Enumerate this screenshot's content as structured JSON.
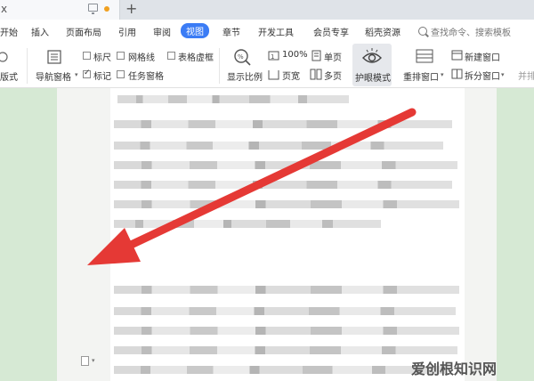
{
  "titlebar": {
    "tab_close_glyph": "x",
    "new_tab_glyph": "+"
  },
  "menu": {
    "items": [
      {
        "label": "开始",
        "active": false
      },
      {
        "label": "插入",
        "active": false
      },
      {
        "label": "页面布局",
        "active": false
      },
      {
        "label": "引用",
        "active": false
      },
      {
        "label": "审阅",
        "active": false
      },
      {
        "label": "视图",
        "active": true
      },
      {
        "label": "章节",
        "active": false
      },
      {
        "label": "开发工具",
        "active": false
      },
      {
        "label": "会员专享",
        "active": false
      },
      {
        "label": "稻壳资源",
        "active": false
      }
    ],
    "search_placeholder": "查找命令、搜索模板"
  },
  "ribbon": {
    "layout_label": "版式",
    "nav_pane_label": "导航窗格",
    "ruler_label": "标尺",
    "gridlines_label": "网格线",
    "table_gridlines_label": "表格虚框",
    "marks_label": "标记",
    "task_pane_label": "任务窗格",
    "zoom_label": "显示比例",
    "zoom_value": "100%",
    "page_width_label": "页宽",
    "single_page_label": "单页",
    "multi_page_label": "多页",
    "eye_mode_label": "护眼模式",
    "arrange_window_label": "重排窗口",
    "new_window_label": "新建窗口",
    "split_window_label": "拆分窗口",
    "side_by_side_label": "并排",
    "checkboxes": {
      "ruler": false,
      "gridlines": false,
      "table_gridlines": false,
      "marks": true,
      "task_pane": false
    }
  },
  "watermark": "爱创根知识网",
  "colors": {
    "accent": "#3b7cf5",
    "eye_bg": "#d6e9d4",
    "arrow": "#e53935"
  },
  "icons": [
    "monitor-icon",
    "search-icon",
    "nav-pane-icon",
    "zoom-icon",
    "eye-icon",
    "arrange-window-icon",
    "new-window-icon",
    "split-window-icon",
    "arrow-annotation"
  ]
}
